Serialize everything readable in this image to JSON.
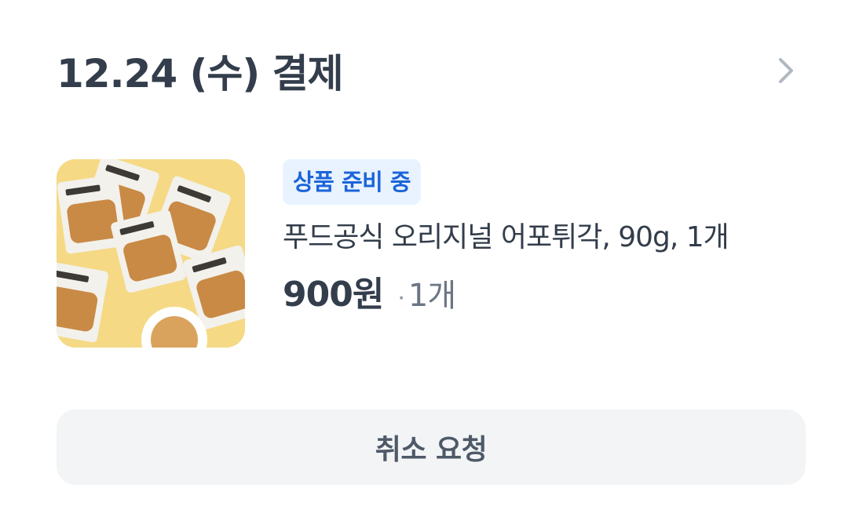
{
  "order": {
    "title": "12.24 (수) 결제",
    "detail_icon": "chevron-right-icon"
  },
  "product": {
    "image": "product-thumbnail",
    "status_badge": "상품 준비 중",
    "name": "푸드공식 오리지널 어포튀각, 90g, 1개",
    "price": "900원",
    "separator": "·",
    "quantity": "1개"
  },
  "actions": {
    "cancel_label": "취소 요청"
  },
  "colors": {
    "title_text": "#333d4b",
    "badge_bg": "#e8f3ff",
    "badge_text": "#1b64da",
    "button_bg": "#f2f4f6",
    "button_text": "#4e5968",
    "muted_text": "#6b7684",
    "chevron": "#b0b8c1"
  }
}
